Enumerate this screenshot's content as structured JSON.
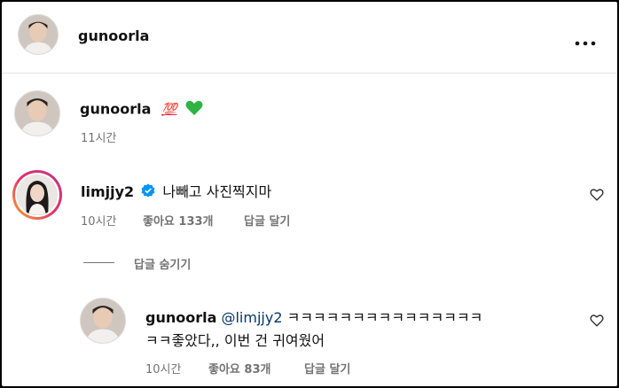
{
  "header": {
    "username": "gunoorla",
    "more_icon": "more-horizontal-icon"
  },
  "caption": {
    "username": "gunoorla",
    "emoji_1": "💯",
    "emoji_2": "💚",
    "time": "11시간"
  },
  "comment": {
    "username": "limjjy2",
    "verified_icon": "verified-badge-icon",
    "text": "나빼고 사진찍지마",
    "time": "10시간",
    "likes": "좋아요 133개",
    "reply_label": "답글 달기",
    "hide_replies": "답글 숨기기",
    "like_icon": "heart-outline-icon"
  },
  "reply": {
    "username": "gunoorla",
    "mention": "@limjjy2",
    "text_line1": "ㅋㅋㅋㅋㅋㅋㅋㅋㅋㅋㅋㅋㅋㅋㅋ",
    "text_line2": "ㅋㅋ좋았다,, 이번 건 귀여웠어",
    "time": "10시간",
    "likes": "좋아요 83개",
    "reply_label": "답글 달기",
    "like_icon": "heart-outline-icon"
  },
  "colors": {
    "text": "#111111",
    "muted": "#737373",
    "verified": "#0095f6",
    "emoji_red": "#e0245e",
    "emoji_green": "#2fb343"
  }
}
